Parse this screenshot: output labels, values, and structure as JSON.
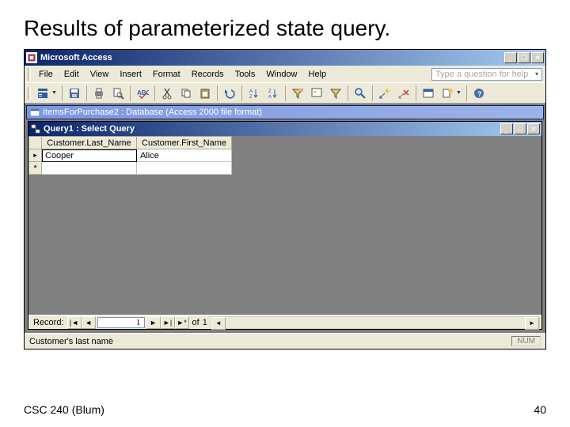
{
  "slide": {
    "title": "Results of parameterized state query.",
    "footer_left": "CSC 240 (Blum)",
    "footer_right": "40"
  },
  "app": {
    "title": "Microsoft Access",
    "help_placeholder": "Type a question for help",
    "menus": [
      "File",
      "Edit",
      "View",
      "Insert",
      "Format",
      "Records",
      "Tools",
      "Window",
      "Help"
    ],
    "db_window_title": "ItemsForPurchase2 : Database (Access 2000 file format)",
    "query_window_title": "Query1 : Select Query",
    "datasheet": {
      "columns": [
        "Customer.Last_Name",
        "Customer.First_Name"
      ],
      "rows": [
        {
          "last": "Cooper",
          "first": "Alice"
        }
      ],
      "new_row_marker": "*"
    },
    "record_nav": {
      "label": "Record:",
      "current": "1",
      "of_label": "of",
      "total": "1"
    },
    "status": {
      "text": "Customer's last name",
      "indicator": "NUM"
    }
  }
}
